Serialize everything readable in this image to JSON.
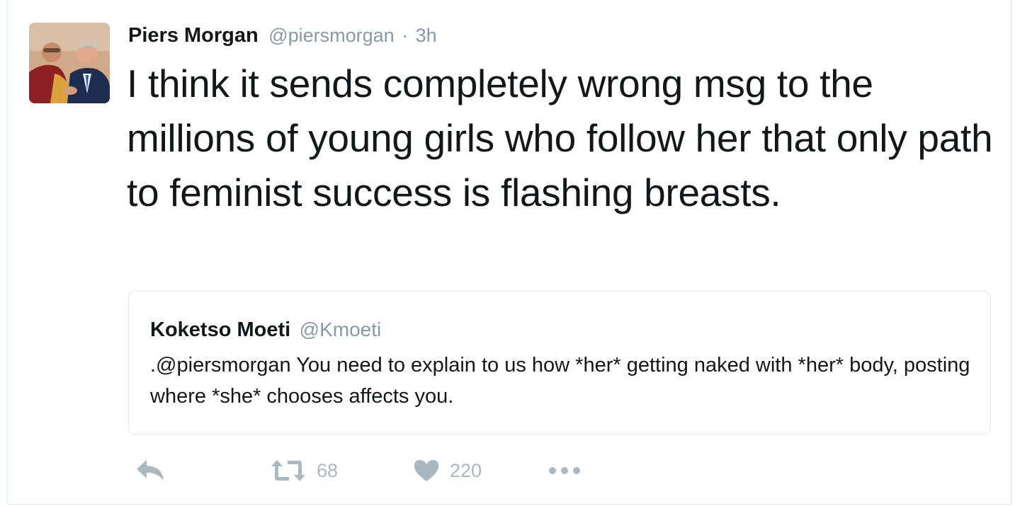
{
  "tweet": {
    "author_name": "Piers Morgan",
    "author_handle": "@piersmorgan",
    "separator": "·",
    "timestamp": "3h",
    "text": "I think it sends completely wrong msg to the millions of young girls who follow her that only path to feminist success is flashing breasts."
  },
  "quoted_tweet": {
    "author_name": "Koketso Moeti",
    "author_handle": "@Kmoeti",
    "text": ".@piersmorgan You need to explain to us how *her* getting naked with *her* body, posting where *she* chooses affects you."
  },
  "actions": {
    "reply_icon": "reply-icon",
    "retweet_icon": "retweet-icon",
    "retweet_count": "68",
    "like_icon": "heart-icon",
    "like_count": "220",
    "more_icon": "more-icon"
  },
  "colors": {
    "text": "#14171a",
    "secondary": "#8899a6",
    "icon": "#aab8c2",
    "border": "#e1e8ed"
  }
}
